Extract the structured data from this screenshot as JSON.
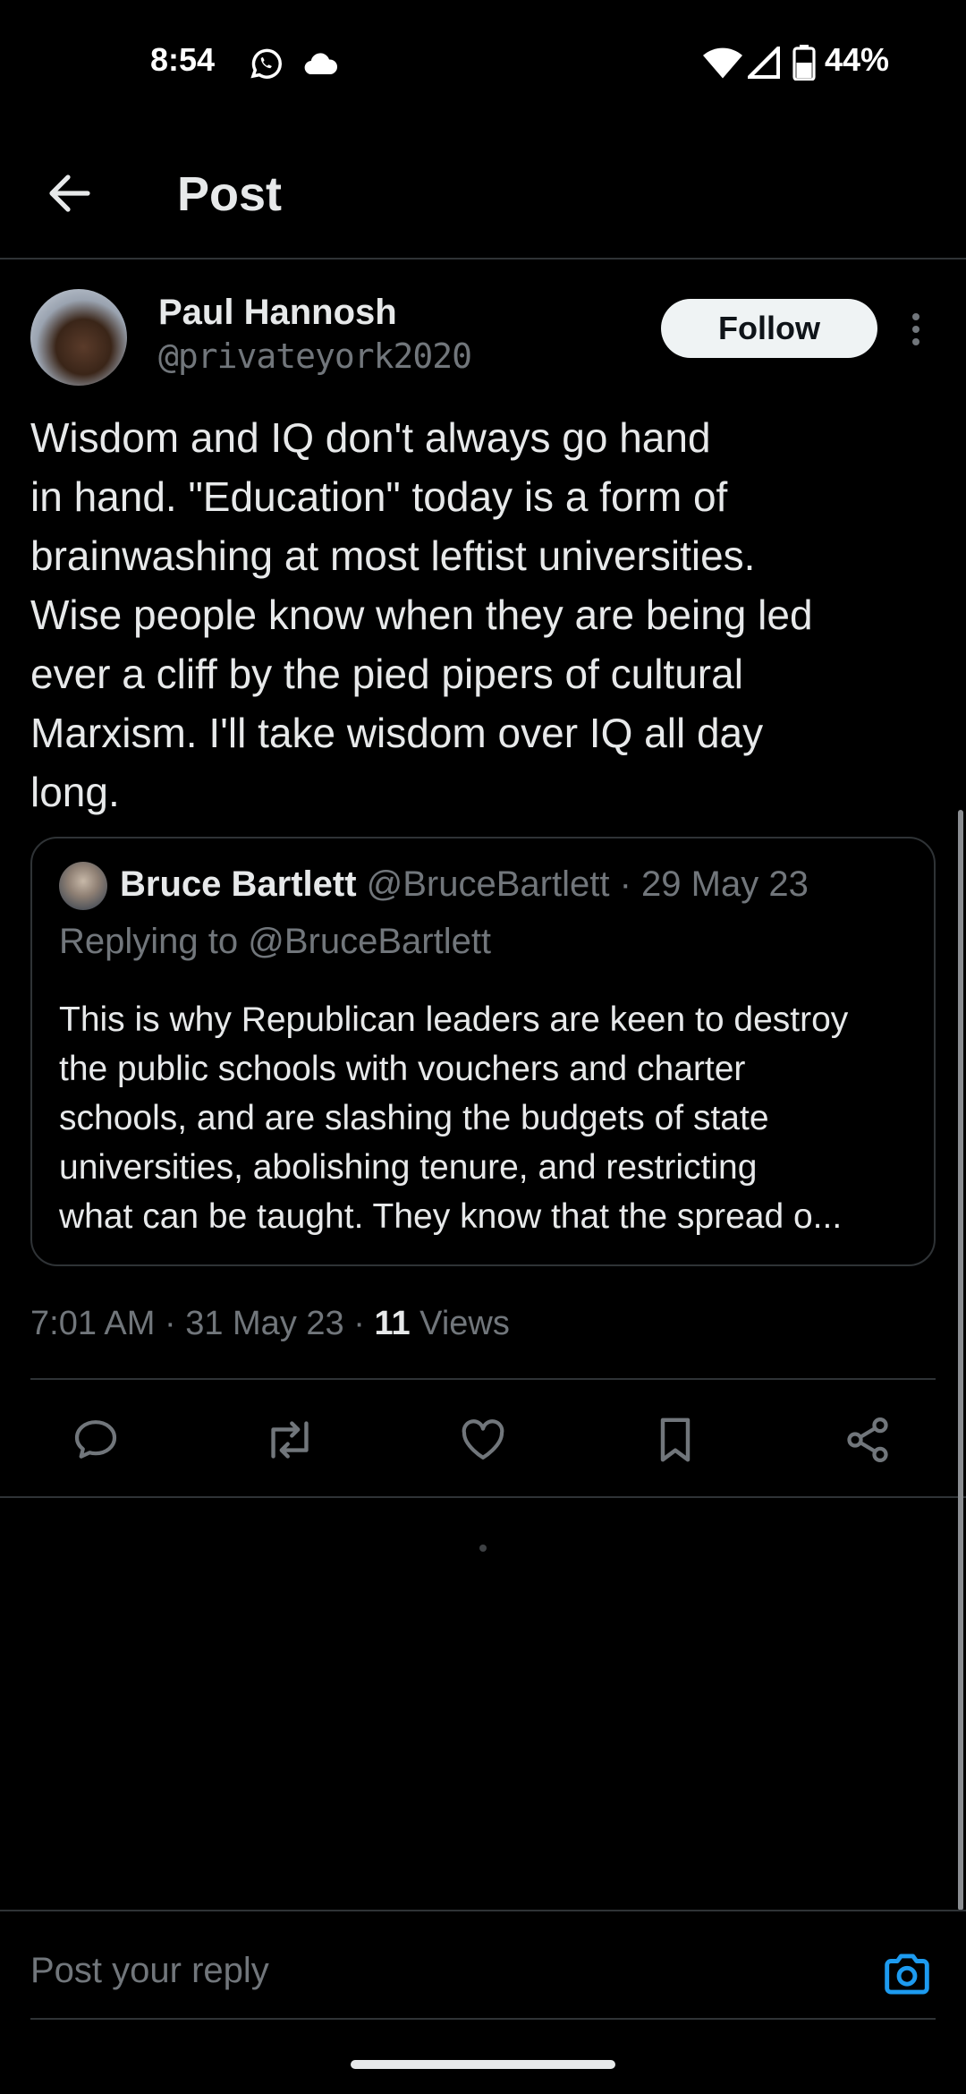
{
  "status_bar": {
    "time": "8:54",
    "battery_percent": "44%",
    "icons": [
      "whatsapp-icon",
      "cloud-icon",
      "wifi-icon",
      "signal-icon",
      "battery-icon"
    ]
  },
  "header": {
    "title": "Post",
    "back_icon": "arrow-left-icon"
  },
  "post": {
    "author_name": "Paul Hannosh",
    "author_handle": "@privateyork2020",
    "follow_label": "Follow",
    "text": "Wisdom and IQ don't always go hand\nin hand. \"Education\" today is a form of\nbrainwashing at most leftist universities.\nWise people know when they are being led\never a cliff by the pied pipers of cultural\nMarxism. I'll take wisdom over IQ all day\nlong.",
    "quote": {
      "name": "Bruce Bartlett",
      "handle": "@BruceBartlett",
      "date": "29 May 23",
      "replying_to": "Replying to @BruceBartlett",
      "text": "This is why Republican leaders are keen to destroy\nthe public schools with vouchers and charter\nschools, and  are slashing the budgets of state\nuniversities, abolishing tenure, and restricting\nwhat can be taught. They know that the spread o..."
    },
    "meta": {
      "time": "7:01 AM",
      "date": "31 May 23",
      "views_count": "11",
      "views_label": "Views"
    }
  },
  "actions": [
    "reply-icon",
    "repost-icon",
    "like-icon",
    "bookmark-icon",
    "share-icon"
  ],
  "reply_bar": {
    "placeholder": "Post your reply"
  },
  "colors": {
    "background": "#000000",
    "text": "#e7e9ea",
    "secondary_text": "#71767b",
    "accent": "#1d9bf0",
    "divider": "#2f3336"
  }
}
